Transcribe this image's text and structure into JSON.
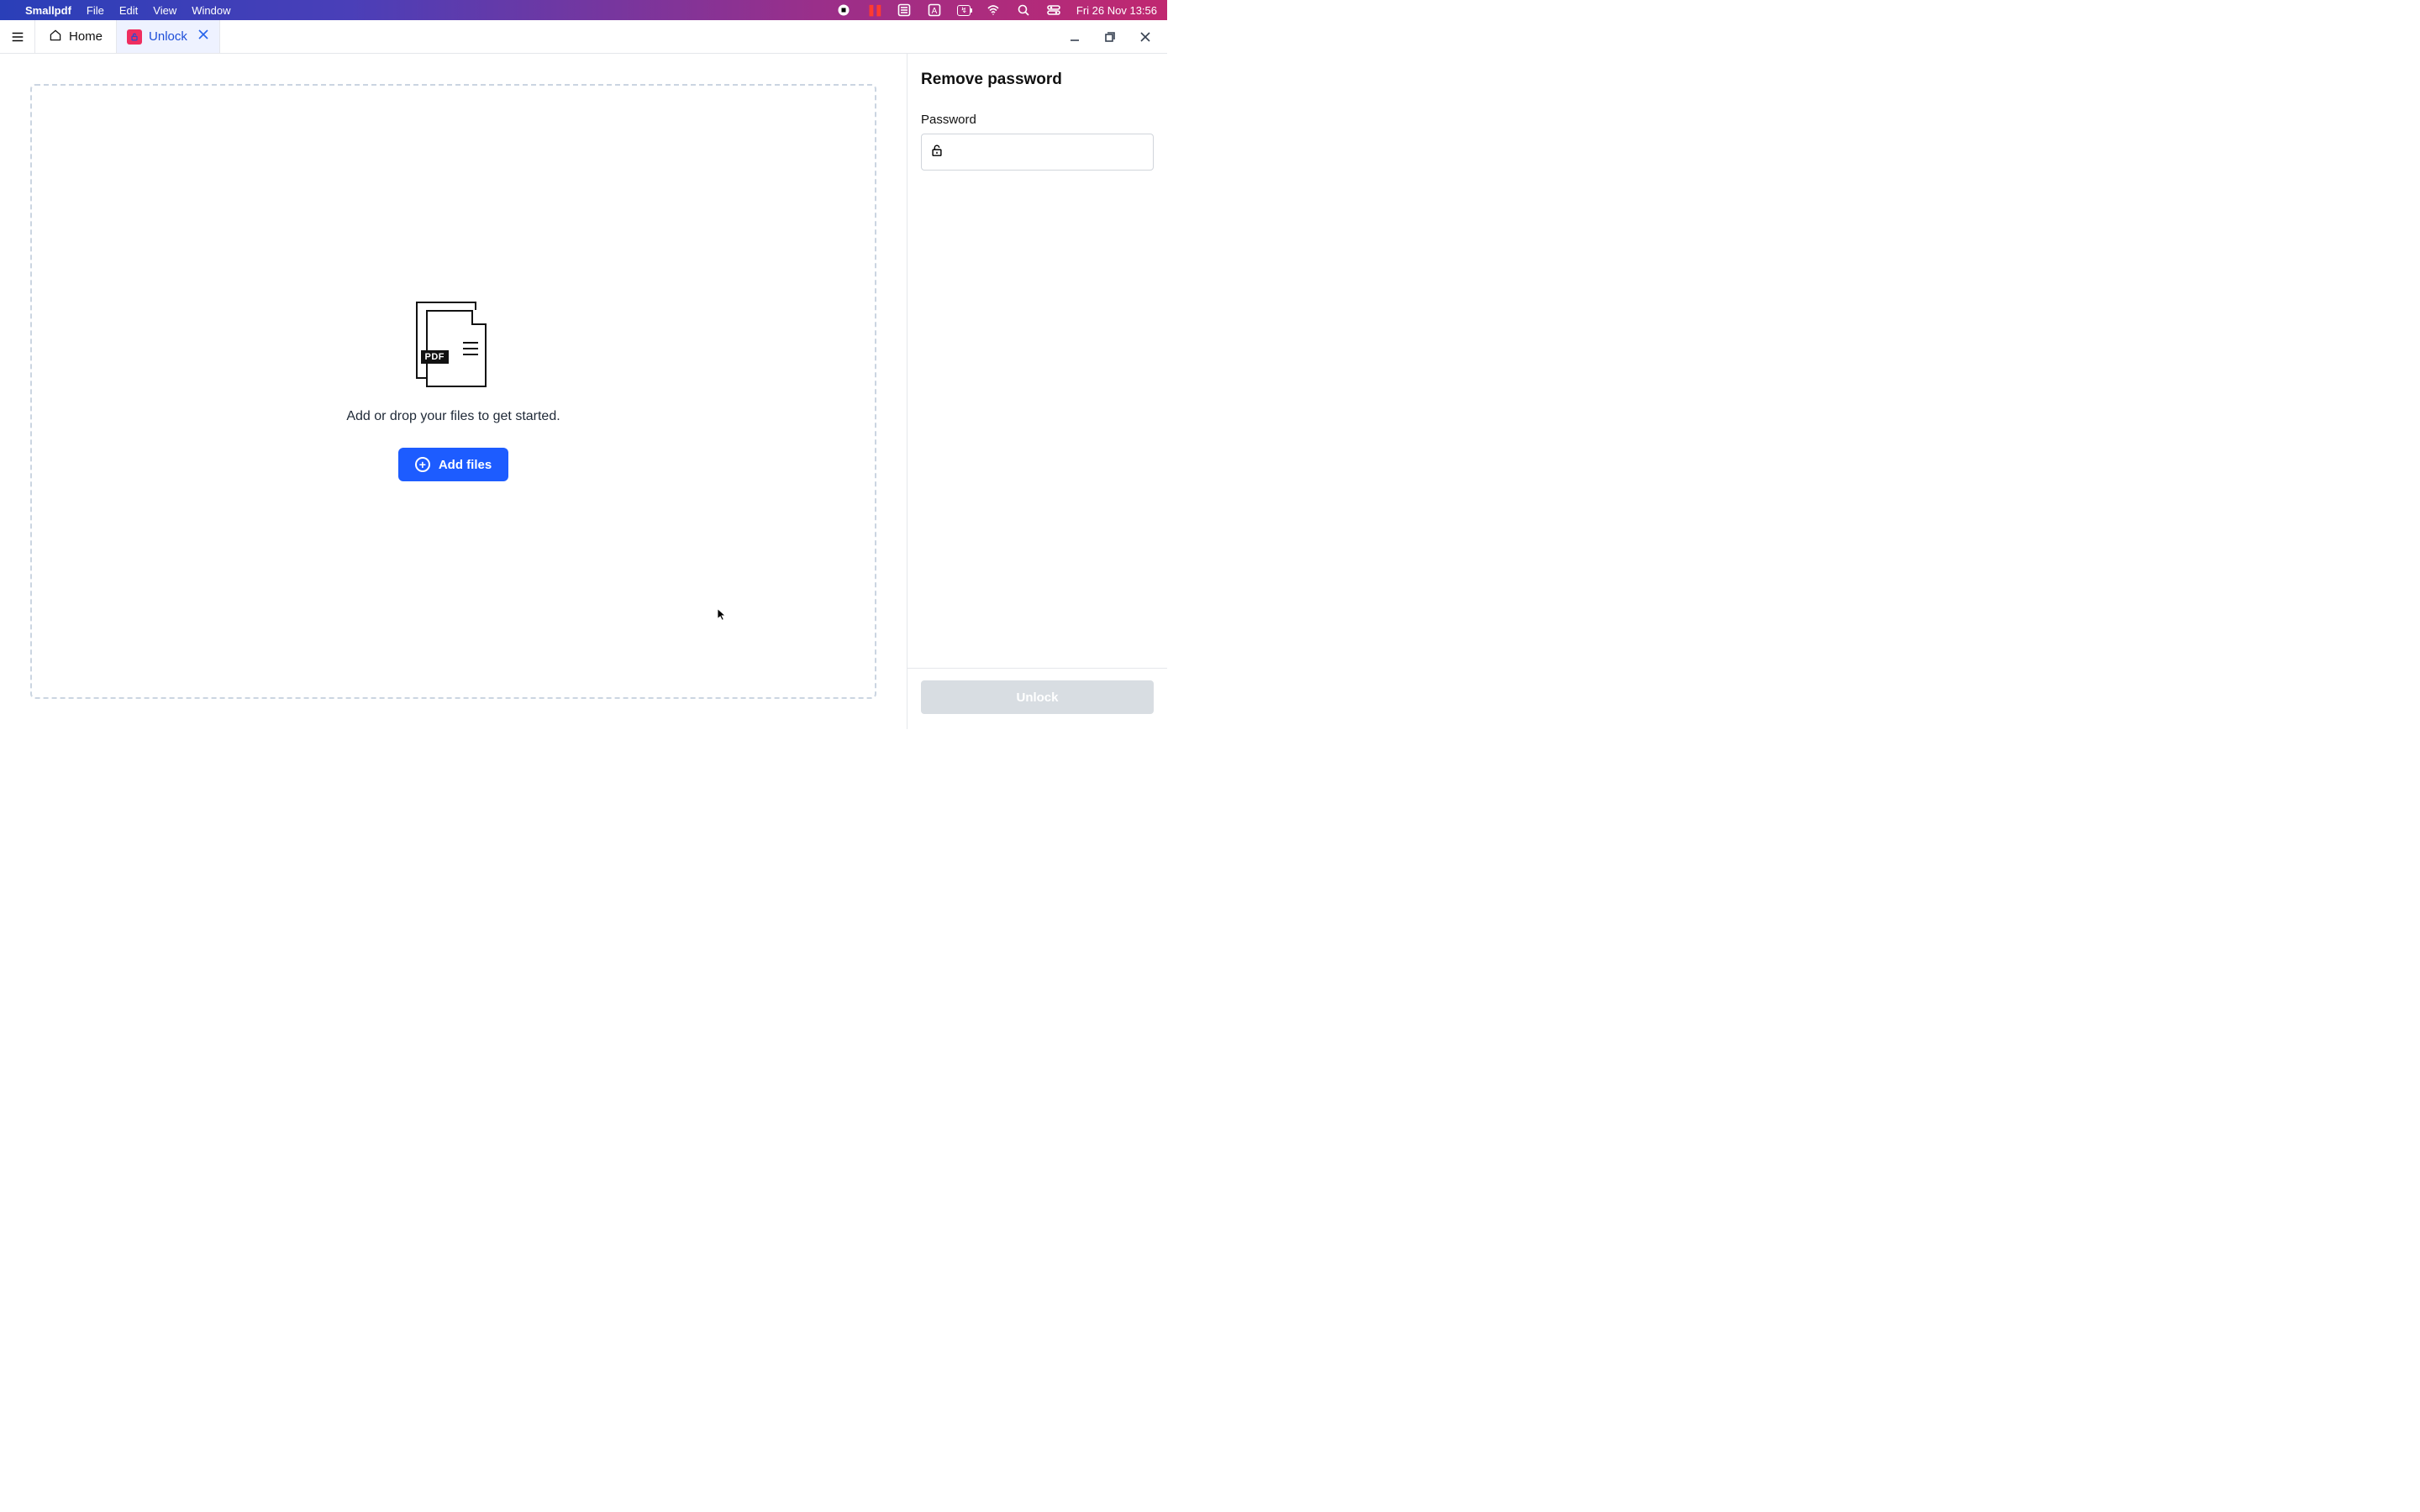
{
  "menubar": {
    "app_name": "Smallpdf",
    "items": [
      "File",
      "Edit",
      "View",
      "Window"
    ],
    "datetime": "Fri 26 Nov  13:56",
    "battery_label": "↯"
  },
  "tabs": {
    "home_label": "Home",
    "unlock_label": "Unlock"
  },
  "dropzone": {
    "pdf_badge": "PDF",
    "hint": "Add or drop your files to get started.",
    "add_button": "Add files"
  },
  "side_panel": {
    "title": "Remove password",
    "password_label": "Password",
    "password_value": "",
    "unlock_button": "Unlock"
  }
}
